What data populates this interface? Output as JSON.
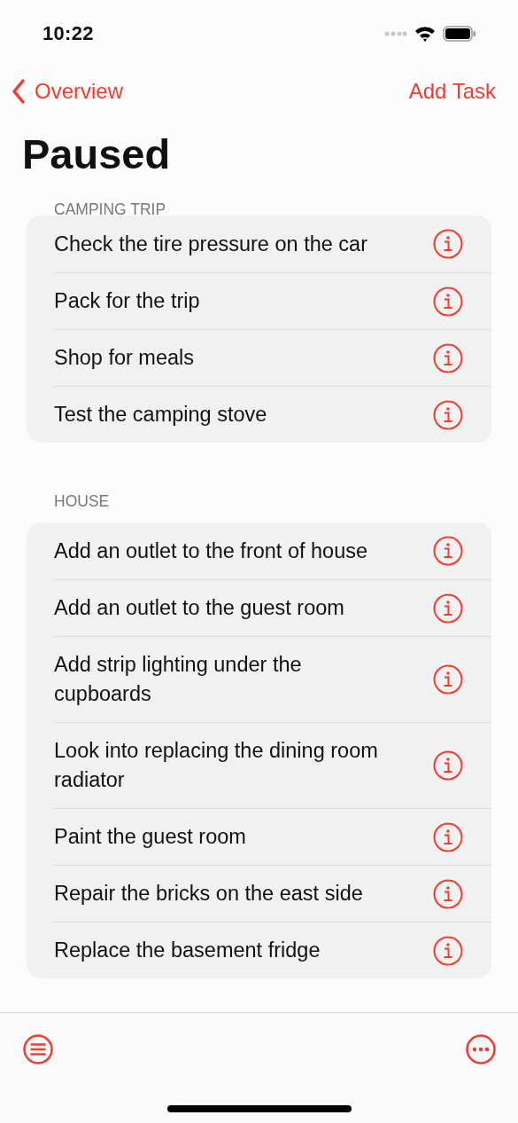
{
  "status_bar": {
    "time": "10:22"
  },
  "nav": {
    "back": "Overview",
    "action": "Add Task"
  },
  "title": "Paused",
  "sections": [
    {
      "header": "CAMPING TRIP",
      "items": [
        {
          "text": "Check the tire pressure on the car"
        },
        {
          "text": "Pack for the trip"
        },
        {
          "text": "Shop for meals"
        },
        {
          "text": "Test the camping stove"
        }
      ]
    },
    {
      "header": "HOUSE",
      "items": [
        {
          "text": "Add an outlet to the front of house"
        },
        {
          "text": "Add an outlet to the guest room"
        },
        {
          "text": "Add strip lighting under the cupboards"
        },
        {
          "text": "Look into replacing the dining room radiator"
        },
        {
          "text": "Paint the guest room"
        },
        {
          "text": "Repair the bricks on the east side"
        },
        {
          "text": "Replace the basement fridge"
        }
      ]
    }
  ]
}
